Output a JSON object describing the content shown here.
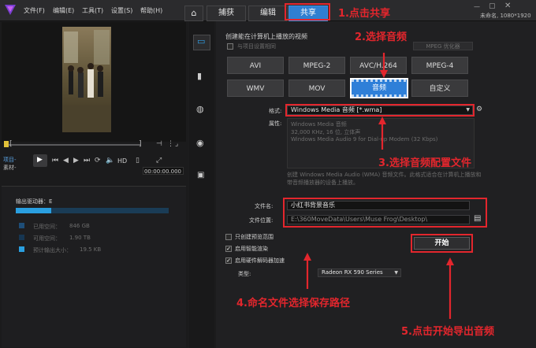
{
  "menu": {
    "file": "文件(F)",
    "edit": "编辑(E)",
    "tools": "工具(T)",
    "settings": "设置(S)",
    "help": "帮助(H)"
  },
  "tabs": {
    "capture": "捕获",
    "edit": "编辑",
    "share": "共享"
  },
  "project_info": "未命名, 1080*1920",
  "annotations": {
    "step1": "1.点击共享",
    "step2": "2.选择音频",
    "step3": "3.选择音频配置文件",
    "step4": "4.命名文件选择保存路径",
    "step5": "5.点击开始导出音频"
  },
  "player": {
    "project_label": "项目-",
    "clip_label": "素材-",
    "hd": "HD",
    "timecode": "00:00:00.000"
  },
  "disk": {
    "output_drive": "输出驱动器：E",
    "used_label": "已用空间：",
    "used_value": "846 GB",
    "free_label": "可用空间：",
    "free_value": "1.90 TB",
    "estimate_label": "预计输出大小：",
    "estimate_value": "19.5 KB",
    "used_fraction": 0.23,
    "colors": {
      "used": "#2a9fe0",
      "bar_bg": "#1a3c56"
    }
  },
  "share": {
    "heading": "创建能在计算机上播放的视频",
    "sub_option": "与项目设置相同",
    "mpeg_option": "MPEG 优化器",
    "formats": [
      "AVI",
      "MPEG-2",
      "AVC/H.264",
      "MPEG-4",
      "WMV",
      "MOV",
      "音频",
      "自定义"
    ],
    "selected_format": "音频",
    "format_label": "格式:",
    "format_value": "Windows Media 音频 [*.wma]",
    "props_label": "属性:",
    "props_lines": [
      "Windows Media 音频",
      "32,000 KHz, 16 位, 立体声",
      "Windows Media Audio 9 for Dial-up Modem (32 Kbps)"
    ],
    "description": "创建 Windows Media Audio (WMA) 音频文件。此格式适合在计算机上播放和带音频播放器的设备上播放。",
    "filename_label": "文件名:",
    "filename_value": "小红书背景音乐",
    "location_label": "文件位置:",
    "location_value": "E:\\360MoveData\\Users\\Muse Frog\\Desktop\\",
    "opt_preview": "只创建预览范围",
    "opt_smart": "启用智能渲染",
    "opt_hw": "启用硬件解码器加速",
    "type_label": "类型:",
    "gpu_value": "Radeon RX 590 Series",
    "start_button": "开始"
  },
  "colors": {
    "accent": "#2f7fd1",
    "annotation": "#e3262d"
  }
}
